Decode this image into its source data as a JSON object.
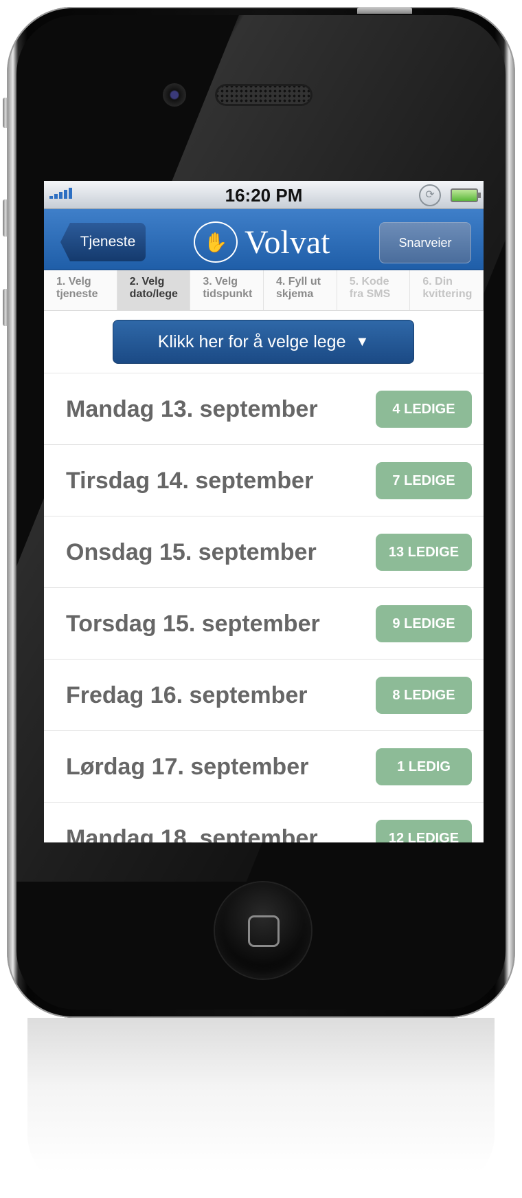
{
  "status_bar": {
    "time": "16:20 PM"
  },
  "nav": {
    "back_label": "Tjeneste",
    "logo_text": "Volvat",
    "shortcut_label": "Snarveier"
  },
  "steps": [
    {
      "line1": "1. Velg",
      "line2": "tjeneste",
      "state": "done"
    },
    {
      "line1": "2. Velg",
      "line2": "dato/lege",
      "state": "active"
    },
    {
      "line1": "3. Velg",
      "line2": "tidspunkt",
      "state": "pending"
    },
    {
      "line1": "4. Fyll ut",
      "line2": "skjema",
      "state": "pending"
    },
    {
      "line1": "5. Kode",
      "line2": "fra SMS",
      "state": "disabled"
    },
    {
      "line1": "6. Din",
      "line2": "kvittering",
      "state": "disabled"
    }
  ],
  "doctor_picker": {
    "label": "Klikk her for å velge lege",
    "arrow": "▼"
  },
  "days": [
    {
      "label": "Mandag 13. september",
      "availability": "4 LEDIGE"
    },
    {
      "label": "Tirsdag 14. september",
      "availability": "7 LEDIGE"
    },
    {
      "label": "Onsdag 15. september",
      "availability": "13 LEDIGE"
    },
    {
      "label": "Torsdag 15. september",
      "availability": "9 LEDIGE"
    },
    {
      "label": "Fredag 16. september",
      "availability": "8 LEDIGE"
    },
    {
      "label": "Lørdag 17. september",
      "availability": "1 LEDIG"
    },
    {
      "label": "Mandag 18. september",
      "availability": "12 LEDIGE"
    }
  ],
  "colors": {
    "nav_blue": "#2a6db8",
    "badge_green": "#8dbb97",
    "picker_blue": "#1f4f8c"
  }
}
